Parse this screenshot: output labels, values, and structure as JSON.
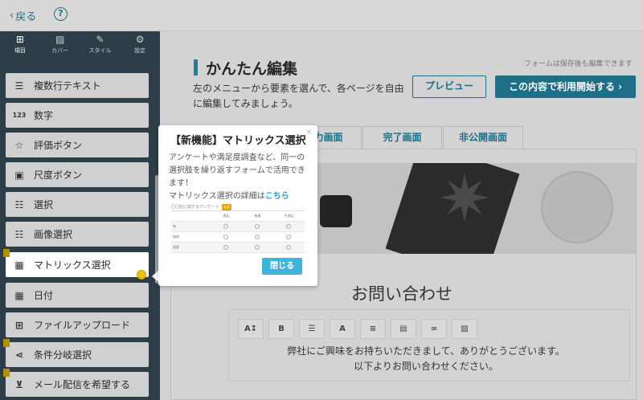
{
  "topbar": {
    "back_label": "戻る",
    "help_glyph": "?"
  },
  "sidebar": {
    "tabs": [
      {
        "label": "項目",
        "icon": "plus-square-icon"
      },
      {
        "label": "カバー",
        "icon": "image-icon"
      },
      {
        "label": "スタイル",
        "icon": "brush-icon"
      },
      {
        "label": "設定",
        "icon": "gear-icon"
      }
    ],
    "items": [
      {
        "label": "複数行テキスト",
        "icon": "multiline-text-icon",
        "glyph": "☰"
      },
      {
        "label": "数字",
        "icon": "number-icon",
        "glyph": "123"
      },
      {
        "label": "評価ボタン",
        "icon": "star-icon",
        "glyph": "☆"
      },
      {
        "label": "尺度ボタン",
        "icon": "scale-icon",
        "glyph": "▣"
      },
      {
        "label": "選択",
        "icon": "radio-list-icon",
        "glyph": "☷"
      },
      {
        "label": "画像選択",
        "icon": "image-choice-icon",
        "glyph": "☷"
      },
      {
        "label": "マトリックス選択",
        "icon": "table-icon",
        "glyph": "▦"
      },
      {
        "label": "日付",
        "icon": "calendar-icon",
        "glyph": "▦"
      },
      {
        "label": "ファイルアップロード",
        "icon": "file-upload-icon",
        "glyph": "⊞"
      },
      {
        "label": "条件分岐選択",
        "icon": "branch-icon",
        "glyph": "⋖"
      },
      {
        "label": "メール配信を希望する",
        "icon": "mail-inbox-icon",
        "glyph": "⊻"
      }
    ]
  },
  "main": {
    "title": "かんたん編集",
    "description": "左のメニューから要素を選んで、各ページを自由に編集してみましょう。",
    "save_note": "フォームは保存後も編集できます",
    "preview_label": "プレビュー",
    "start_label": "この内容で利用開始する ›",
    "tabs": [
      "入力画面",
      "完了画面",
      "非公開画面"
    ],
    "form_title": "お問い合わせ",
    "editor_lines": [
      "弊社にご興味をお持ちいただきまして、ありがとうございます。",
      "以下よりお問い合わせください。"
    ],
    "toolbar": [
      "A↕",
      "B",
      "☰",
      "A",
      "≡",
      "▤",
      "∞",
      "▨"
    ]
  },
  "popup": {
    "title": "【新機能】マトリックス選択",
    "body": "アンケートや満足度調査など、同一の選択肢を繰り返すフォームで活用できます！",
    "detail_prefix": "マトリックス選択の詳細は",
    "detail_link": "こちら",
    "close_x": "×",
    "close_button": "閉じる",
    "sample": {
      "caption": "〇〇店に関するアンケート",
      "badge": "必須",
      "columns": [
        "",
        "満足",
        "普通",
        "不満足"
      ],
      "rows": [
        "味",
        "価格",
        "接客"
      ]
    }
  }
}
